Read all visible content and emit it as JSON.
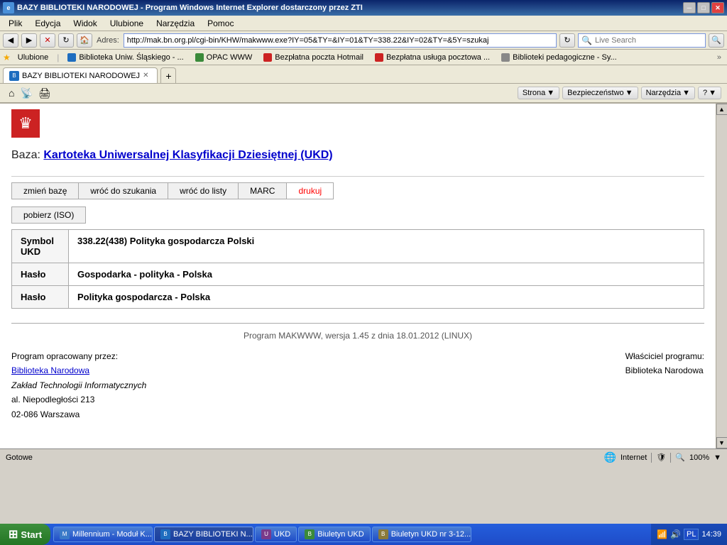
{
  "titlebar": {
    "title": "BAZY BIBLIOTEKI NARODOWEJ - Program Windows Internet Explorer dostarczony przez ZTI",
    "minimize": "─",
    "maximize": "□",
    "close": "✕"
  },
  "menubar": {
    "items": [
      "Plik",
      "Edycja",
      "Widok",
      "Ulubione",
      "Narzędzia",
      "Pomoc"
    ]
  },
  "addressbar": {
    "url": "http://mak.bn.org.pl/cgi-bin/KHW/makwww.exe?IY=05&TY=&IY=01&TY=338.22&IY=02&TY=&5Y=szukaj",
    "live_search_placeholder": "Live Search"
  },
  "favoritesbar": {
    "favorites_label": "Ulubione",
    "items": [
      "Biblioteka Uniw. Śląskiego - ...",
      "OPAC WWW",
      "Bezpłatna poczta Hotmail",
      "Bezpłatna usługa pocztowa ...",
      "Biblioteki pedagogiczne - Sy..."
    ]
  },
  "tab": {
    "label": "BAZY BIBLIOTEKI NARODOWEJ",
    "new_tab": "+"
  },
  "toolbar": {
    "strona": "Strona",
    "bezpieczenstwo": "Bezpieczeństwo",
    "narzedzia": "Narzędzia",
    "help": "?"
  },
  "page": {
    "baza_label": "Baza:",
    "baza_link": "Kartoteka Uniwersalnej Klasyfikacji Dziesiętnej (UKD)",
    "buttons": {
      "zmien_baze": "zmień bazę",
      "wróc_do_szukania": "wróć do szukania",
      "wróc_do_listy": "wróć do listy",
      "marc": "MARC",
      "drukuj": "drukuj"
    },
    "pobierz": "pobierz (ISO)",
    "table": {
      "rows": [
        {
          "label1": "Symbol",
          "label2": "UKD",
          "value": "338.22(438) Polityka gospodarcza Polski"
        },
        {
          "label1": "Hasło",
          "label2": "",
          "value": "Gospodarka - polityka - Polska"
        },
        {
          "label1": "Hasło",
          "label2": "",
          "value": "Polityka gospodarcza - Polska"
        }
      ]
    },
    "footer": {
      "program_info": "Program MAKWWW, wersja 1.45 z dnia 18.01.2012 (LINUX)",
      "opracowany_label": "Program opracowany przez:",
      "biblioteka_link": "Biblioteka Narodowa",
      "org_name": "Zakład Technologii Informatycznych",
      "address1": "al. Niepodległości 213",
      "address2": "02-086 Warszawa",
      "wlasciciel_label": "Właściciel programu:",
      "wlasciciel_value": "Biblioteka Narodowa"
    }
  },
  "statusbar": {
    "status": "Gotowe",
    "zone": "Internet",
    "zoom": "100%"
  },
  "taskbar": {
    "start_label": "Start",
    "items": [
      {
        "label": "Millennium - Moduł K...",
        "icon": "M"
      },
      {
        "label": "BAZY BIBLIOTEKI N...",
        "icon": "B",
        "active": true
      },
      {
        "label": "UKD",
        "icon": "U"
      },
      {
        "label": "Biuletyn UKD",
        "icon": "B2"
      },
      {
        "label": "Biuletyn UKD nr 3-12...",
        "icon": "B3"
      }
    ],
    "lang": "PL",
    "time": "14:39"
  }
}
